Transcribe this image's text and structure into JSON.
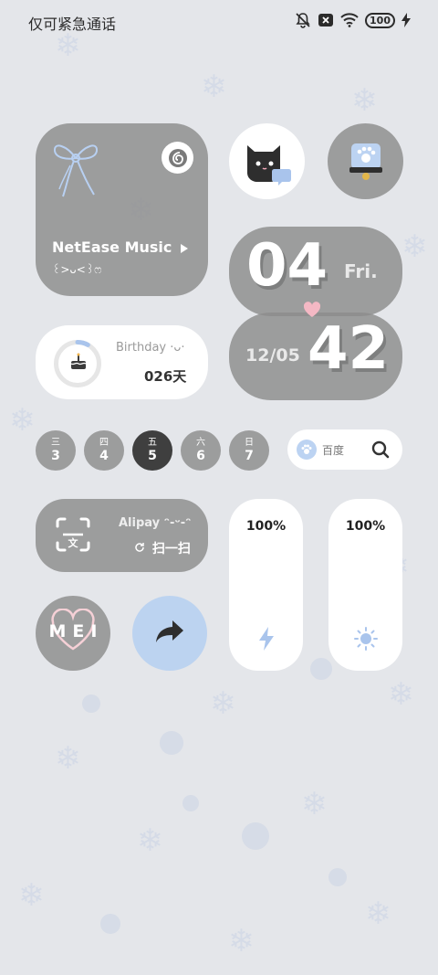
{
  "status_bar": {
    "carrier_text": "仅可紧急通话",
    "battery_level": "100",
    "icons": [
      "mute-icon",
      "no-sim-icon",
      "wifi-icon",
      "battery-icon",
      "charging-icon"
    ]
  },
  "music_widget": {
    "title": "NetEase Music",
    "subtitle": "꒰>ᴗ<꒱ෆ",
    "icons": [
      "ribbon-bow-icon",
      "netease-icon",
      "play-icon"
    ]
  },
  "chat_app": {
    "icon": "black-cat-chat-icon"
  },
  "bell_app": {
    "icon": "paw-bell-icon"
  },
  "clock": {
    "hour": "04",
    "minute": "42",
    "weekday": "Fri.",
    "date": "12/05"
  },
  "birthday_widget": {
    "label": "Birthday ·ᴗ·",
    "days_left": "026天",
    "progress_fraction": 0.08
  },
  "week": [
    {
      "weekday": "三",
      "day": "3",
      "active": false
    },
    {
      "weekday": "四",
      "day": "4",
      "active": false
    },
    {
      "weekday": "五",
      "day": "5",
      "active": true
    },
    {
      "weekday": "六",
      "day": "6",
      "active": false
    },
    {
      "weekday": "日",
      "day": "7",
      "active": false
    }
  ],
  "search": {
    "label": "百度"
  },
  "alipay_widget": {
    "title": "Alipay ᵔ-ᵕ-ᵔ",
    "action": "扫一扫"
  },
  "sliders": [
    {
      "value": "100%",
      "icon": "flash-icon"
    },
    {
      "value": "100%",
      "icon": "brightness-icon"
    }
  ],
  "mei_widget": {
    "text": "MEI"
  },
  "colors": {
    "accent_blue": "#a9c4ec",
    "widget_grey": "#8c8c8c",
    "heart_pink": "#f4b8c4"
  }
}
